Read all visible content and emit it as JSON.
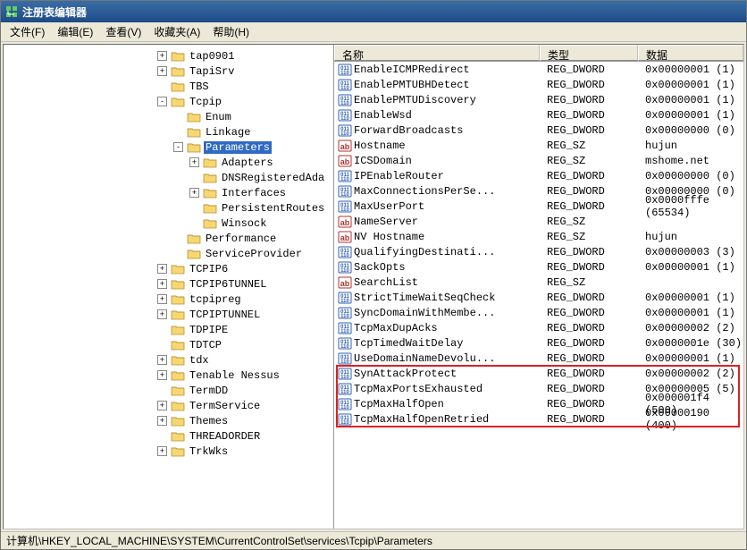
{
  "window": {
    "title": "注册表编辑器"
  },
  "menu": {
    "file": "文件(F)",
    "edit": "编辑(E)",
    "view": "查看(V)",
    "favorites": "收藏夹(A)",
    "help": "帮助(H)"
  },
  "columns": {
    "name": "名称",
    "type": "类型",
    "data": "数据"
  },
  "tree": [
    {
      "indent": 5,
      "toggle": "+",
      "label": "tap0901"
    },
    {
      "indent": 5,
      "toggle": "+",
      "label": "TapiSrv"
    },
    {
      "indent": 5,
      "toggle": " ",
      "label": "TBS"
    },
    {
      "indent": 5,
      "toggle": "-",
      "label": "Tcpip"
    },
    {
      "indent": 6,
      "toggle": " ",
      "label": "Enum"
    },
    {
      "indent": 6,
      "toggle": " ",
      "label": "Linkage"
    },
    {
      "indent": 6,
      "toggle": "-",
      "label": "Parameters",
      "selected": true
    },
    {
      "indent": 7,
      "toggle": "+",
      "label": "Adapters"
    },
    {
      "indent": 7,
      "toggle": " ",
      "label": "DNSRegisteredAda"
    },
    {
      "indent": 7,
      "toggle": "+",
      "label": "Interfaces"
    },
    {
      "indent": 7,
      "toggle": " ",
      "label": "PersistentRoutes"
    },
    {
      "indent": 7,
      "toggle": " ",
      "label": "Winsock"
    },
    {
      "indent": 6,
      "toggle": " ",
      "label": "Performance"
    },
    {
      "indent": 6,
      "toggle": " ",
      "label": "ServiceProvider"
    },
    {
      "indent": 5,
      "toggle": "+",
      "label": "TCPIP6"
    },
    {
      "indent": 5,
      "toggle": "+",
      "label": "TCPIP6TUNNEL"
    },
    {
      "indent": 5,
      "toggle": "+",
      "label": "tcpipreg"
    },
    {
      "indent": 5,
      "toggle": "+",
      "label": "TCPIPTUNNEL"
    },
    {
      "indent": 5,
      "toggle": " ",
      "label": "TDPIPE"
    },
    {
      "indent": 5,
      "toggle": " ",
      "label": "TDTCP"
    },
    {
      "indent": 5,
      "toggle": "+",
      "label": "tdx"
    },
    {
      "indent": 5,
      "toggle": "+",
      "label": "Tenable Nessus"
    },
    {
      "indent": 5,
      "toggle": " ",
      "label": "TermDD"
    },
    {
      "indent": 5,
      "toggle": "+",
      "label": "TermService"
    },
    {
      "indent": 5,
      "toggle": "+",
      "label": "Themes"
    },
    {
      "indent": 5,
      "toggle": " ",
      "label": "THREADORDER"
    },
    {
      "indent": 5,
      "toggle": "+",
      "label": "TrkWks"
    }
  ],
  "values": [
    {
      "icon": "dw",
      "name": "EnableICMPRedirect",
      "type": "REG_DWORD",
      "data": "0x00000001 (1)"
    },
    {
      "icon": "dw",
      "name": "EnablePMTUBHDetect",
      "type": "REG_DWORD",
      "data": "0x00000001 (1)"
    },
    {
      "icon": "dw",
      "name": "EnablePMTUDiscovery",
      "type": "REG_DWORD",
      "data": "0x00000001 (1)"
    },
    {
      "icon": "dw",
      "name": "EnableWsd",
      "type": "REG_DWORD",
      "data": "0x00000001 (1)"
    },
    {
      "icon": "dw",
      "name": "ForwardBroadcasts",
      "type": "REG_DWORD",
      "data": "0x00000000 (0)"
    },
    {
      "icon": "sz",
      "name": "Hostname",
      "type": "REG_SZ",
      "data": "hujun"
    },
    {
      "icon": "sz",
      "name": "ICSDomain",
      "type": "REG_SZ",
      "data": "mshome.net"
    },
    {
      "icon": "dw",
      "name": "IPEnableRouter",
      "type": "REG_DWORD",
      "data": "0x00000000 (0)"
    },
    {
      "icon": "dw",
      "name": "MaxConnectionsPerSe...",
      "type": "REG_DWORD",
      "data": "0x00000000 (0)"
    },
    {
      "icon": "dw",
      "name": "MaxUserPort",
      "type": "REG_DWORD",
      "data": "0x0000fffe (65534)"
    },
    {
      "icon": "sz",
      "name": "NameServer",
      "type": "REG_SZ",
      "data": ""
    },
    {
      "icon": "sz",
      "name": "NV Hostname",
      "type": "REG_SZ",
      "data": "hujun"
    },
    {
      "icon": "dw",
      "name": "QualifyingDestinati...",
      "type": "REG_DWORD",
      "data": "0x00000003 (3)"
    },
    {
      "icon": "dw",
      "name": "SackOpts",
      "type": "REG_DWORD",
      "data": "0x00000001 (1)"
    },
    {
      "icon": "sz",
      "name": "SearchList",
      "type": "REG_SZ",
      "data": ""
    },
    {
      "icon": "dw",
      "name": "StrictTimeWaitSeqCheck",
      "type": "REG_DWORD",
      "data": "0x00000001 (1)"
    },
    {
      "icon": "dw",
      "name": "SyncDomainWithMembe...",
      "type": "REG_DWORD",
      "data": "0x00000001 (1)"
    },
    {
      "icon": "dw",
      "name": "TcpMaxDupAcks",
      "type": "REG_DWORD",
      "data": "0x00000002 (2)"
    },
    {
      "icon": "dw",
      "name": "TcpTimedWaitDelay",
      "type": "REG_DWORD",
      "data": "0x0000001e (30)"
    },
    {
      "icon": "dw",
      "name": "UseDomainNameDevolu...",
      "type": "REG_DWORD",
      "data": "0x00000001 (1)"
    },
    {
      "icon": "dw",
      "name": "SynAttackProtect",
      "type": "REG_DWORD",
      "data": "0x00000002 (2)",
      "hl": true
    },
    {
      "icon": "dw",
      "name": "TcpMaxPortsExhausted",
      "type": "REG_DWORD",
      "data": "0x00000005 (5)",
      "hl": true
    },
    {
      "icon": "dw",
      "name": "TcpMaxHalfOpen",
      "type": "REG_DWORD",
      "data": "0x000001f4 (500)",
      "hl": true
    },
    {
      "icon": "dw",
      "name": "TcpMaxHalfOpenRetried",
      "type": "REG_DWORD",
      "data": "0x00000190 (400)",
      "hl": true
    }
  ],
  "statusbar": {
    "path": "计算机\\HKEY_LOCAL_MACHINE\\SYSTEM\\CurrentControlSet\\services\\Tcpip\\Parameters"
  }
}
